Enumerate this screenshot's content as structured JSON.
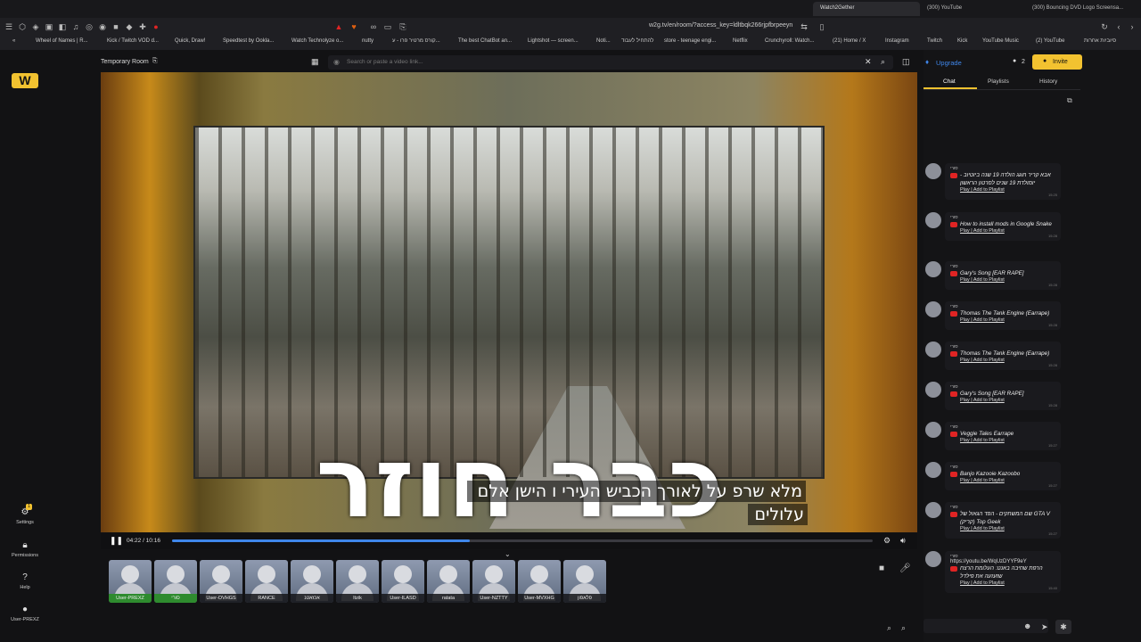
{
  "browser": {
    "tabs": [
      {
        "label": "Watch2Gether",
        "active": true
      },
      {
        "label": "(300) YouTube",
        "active": false
      },
      {
        "label": "(300) Bouncing DVD Logo Screensa...",
        "active": false
      }
    ],
    "url": "w2g.tv/en/room/?access_key=ldltbqk266rjpfbrpeeyn",
    "bookmarks": [
      "Wheel of Names | R...",
      "Kick / Twitch VOD d...",
      "Quick, Draw!",
      "Speedtest by Ookla...",
      "Watch Technolyze o...",
      "nutty",
      "קורס מרטיר פרו - ע...",
      "The best ChatBot an...",
      "Lightshot — screen...",
      "Noti...",
      "להתחיל לעבוד",
      "store - teenage engi...",
      "Netflix",
      "Crunchyroll: Watch...",
      "(21) Home / X",
      "Instagram",
      "Twitch",
      "Kick",
      "YouTube Music",
      "(2) YouTube",
      "סיוביות אחרות"
    ]
  },
  "nav": {
    "logo_label": "W",
    "settings_label": "Settings",
    "settings_badge": "1",
    "permissions_label": "Permissions",
    "help_label": "Help",
    "user_label": "User-PREXZ"
  },
  "room": {
    "title": "Temporary Room",
    "search_placeholder": "Search or paste a video link..."
  },
  "header_actions": {
    "upgrade_label": "Upgrade",
    "user_count": "2",
    "invite_label": "Invite"
  },
  "video": {
    "overlay_text": "כבר חוזר",
    "subtitle_line1": "מלא שרפ על לאורך הכביש העירי ו הישן אלם",
    "subtitle_line2": "עלולים",
    "time": "04:22 / 10:16",
    "progress": 0.425
  },
  "users": [
    {
      "name": "User-PREXZ",
      "me": true
    },
    {
      "name": "סורי",
      "me": true
    },
    {
      "name": "User-OVHGS",
      "me": false
    },
    {
      "name": "RANCE",
      "me": false
    },
    {
      "name": "אכזאטנ",
      "me": false
    },
    {
      "name": "Itzik",
      "me": false
    },
    {
      "name": "User-ILASD",
      "me": false
    },
    {
      "name": "ratata",
      "me": false
    },
    {
      "name": "User-NZTTY",
      "me": false
    },
    {
      "name": "User-MVXHG",
      "me": false
    },
    {
      "name": "פלאפון",
      "me": false
    }
  ],
  "panel": {
    "tabs": [
      "Chat",
      "Playlists",
      "History"
    ],
    "active_tab": "Chat",
    "chat_messages": [
      {
        "author": "סורי",
        "title": "אבא קריר חוגג הולדה 19 שנה ביוטיוב - יומולדת 19 שנים לסרטון הראשון",
        "links": "Play | Add to Playlist",
        "time": "15:25"
      },
      {
        "author": "סורי",
        "title": "How to install mods in Google Snake",
        "links": "Play | Add to Playlist",
        "time": "15:28"
      },
      {
        "author": "סורי",
        "title": "Gary's Song [EAR RAPE]",
        "links": "Play | Add to Playlist",
        "time": "15:28"
      },
      {
        "author": "סורי",
        "title": "Thomas The Tank Engine (Earrape)",
        "links": "Play | Add to Playlist",
        "time": "15:28"
      },
      {
        "author": "סורי",
        "title": "Thomas The Tank Engine (Earrape)",
        "links": "Play | Add to Playlist",
        "time": "15:28"
      },
      {
        "author": "סורי",
        "title": "Gary's Song [EAR RAPE]",
        "links": "Play | Add to Playlist",
        "time": "15:28"
      },
      {
        "author": "סורי",
        "title": "Veggie Tales Earrape",
        "links": "Play | Add to Playlist",
        "time": "15:27"
      },
      {
        "author": "סורי",
        "title": "Banjo Kazooie Kazoobo",
        "links": "Play | Add to Playlist",
        "time": "15:27"
      },
      {
        "author": "סורי",
        "title": "שם המשחקים - הפד הגאול של GTA V (קריק) Top Geek",
        "links": "Play | Add to Playlist",
        "time": "15:27"
      },
      {
        "author": "סורי",
        "url": "https://youtu.be/WqUzDYYF9eY",
        "title": "הרפת שחיבה באנט: העלומת הרצח שזעזעה את פילדל",
        "links": "Play | Add to Playlist",
        "time": "15:40"
      }
    ]
  },
  "colors": {
    "accent": "#f2c230",
    "progress": "#3f86ea",
    "upgrade": "#3f86ea",
    "youtube": "#e02424",
    "me_name": "#2e8b2e"
  }
}
